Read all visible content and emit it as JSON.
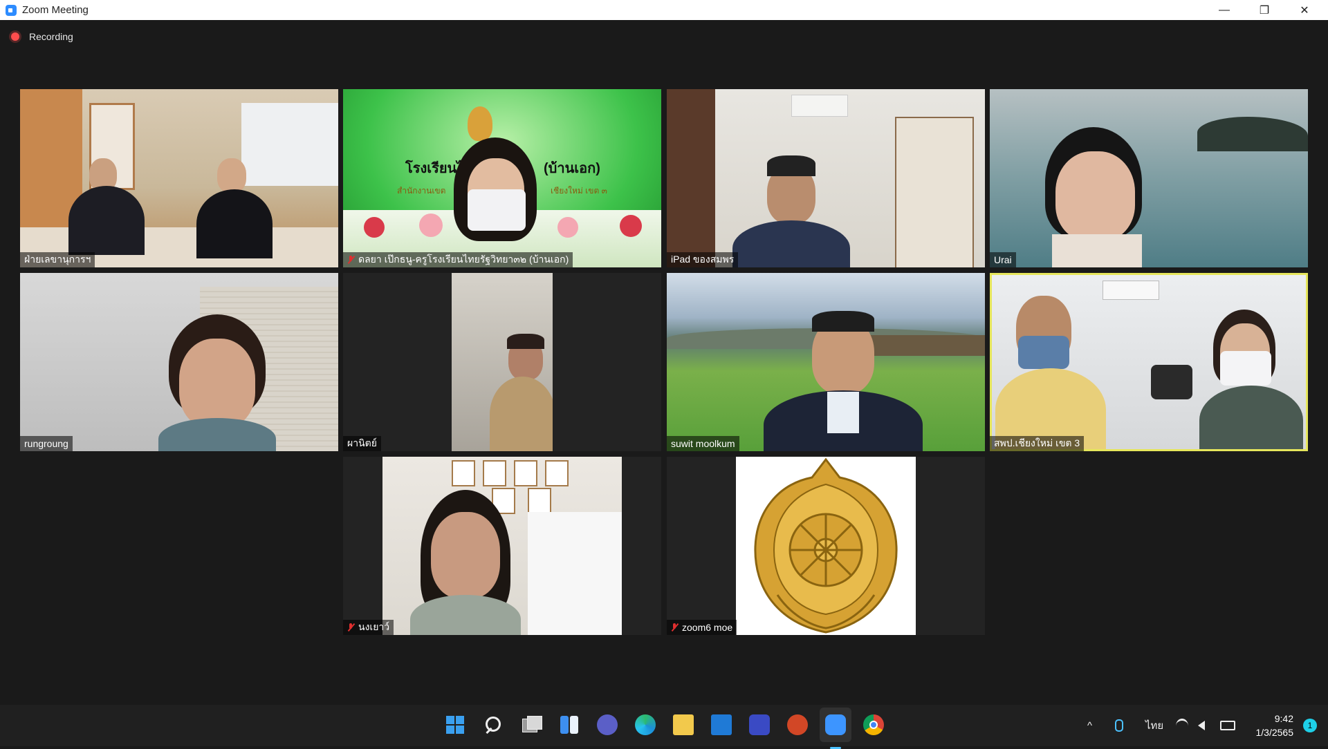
{
  "window": {
    "title": "Zoom Meeting",
    "minimize": "—",
    "restore": "❐",
    "close": "✕"
  },
  "recording": {
    "label": "Recording"
  },
  "participants": [
    {
      "name": "ฝ่ายเลขานุการฯ",
      "muted": false
    },
    {
      "name": "ดลยา เป๊กธนู-ครูโรงเรียนไทยรัฐวิทยา๓๒ (บ้านเอก)",
      "muted": true
    },
    {
      "name": "iPad ของสมพร",
      "muted": false
    },
    {
      "name": "Urai",
      "muted": false
    },
    {
      "name": "rungroung",
      "muted": false
    },
    {
      "name": "ผานิตย์",
      "muted": false
    },
    {
      "name": "suwit moolkum",
      "muted": false
    },
    {
      "name": "สพป.เชียงใหม่ เขต 3",
      "muted": false,
      "active_speaker": true
    },
    {
      "name": "นงเยาว์",
      "muted": true
    },
    {
      "name": "zoom6 moe",
      "muted": true
    }
  ],
  "banner": {
    "line1_left": "โรงเรียนไ",
    "line1_right": "(บ้านเอก)",
    "line2_left": "สำนักงานเขต",
    "line2_right": "เชียงใหม่ เขต ๓"
  },
  "taskbar": {
    "icons": [
      "windows-start-icon",
      "search-icon",
      "task-view-icon",
      "widgets-icon",
      "teams-chat-icon",
      "edge-icon",
      "file-explorer-icon",
      "mail-icon",
      "app-icon",
      "powerpoint-icon",
      "zoom-icon",
      "chrome-icon"
    ],
    "tray": {
      "chevron": "^",
      "language": "ไทย",
      "time": "9:42",
      "date": "1/3/2565",
      "notifications": "1"
    }
  },
  "colors": {
    "active_speaker_border": "#e6e65c",
    "mute_red": "#e02f2f",
    "zoom_blue": "#2d8cff",
    "recording_red": "#ff4d4d"
  }
}
